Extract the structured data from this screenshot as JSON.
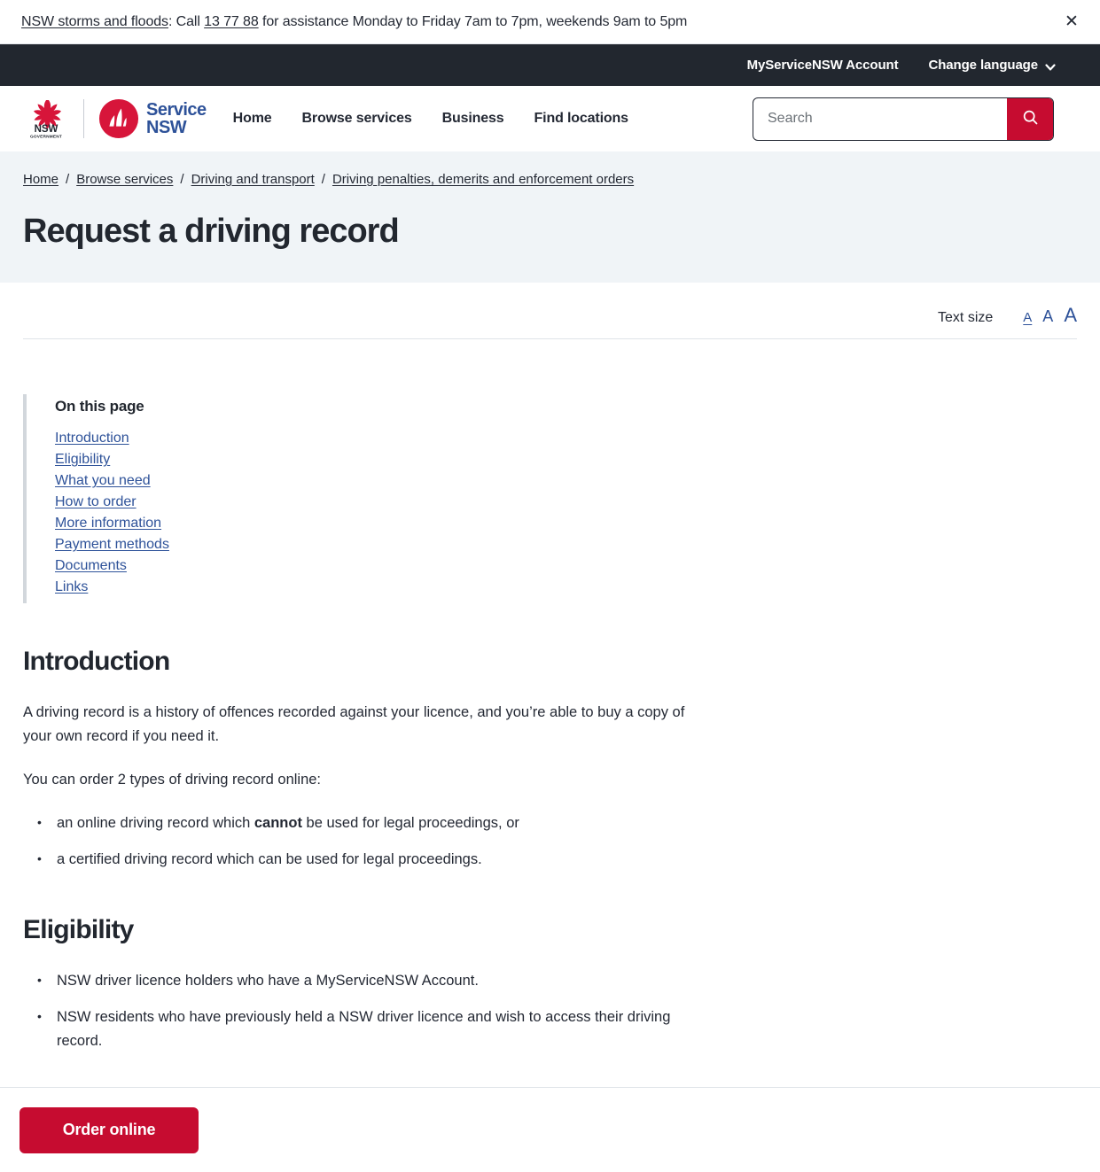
{
  "alert": {
    "link_text": "NSW storms and floods",
    "mid_text": ": Call ",
    "phone": "13 77 88",
    "tail_text": " for assistance Monday to Friday 7am to 7pm, weekends 9am to 5pm",
    "close_label": "✕"
  },
  "utility": {
    "account_label": "MyServiceNSW Account",
    "language_label": "Change language"
  },
  "header": {
    "logo_nsw_line1": "NSW",
    "logo_nsw_line2": "GOVERNMENT",
    "logo_service_line1": "Service",
    "logo_service_line2": "NSW",
    "nav": [
      {
        "label": "Home"
      },
      {
        "label": "Browse services"
      },
      {
        "label": "Business"
      },
      {
        "label": "Find locations"
      }
    ],
    "search": {
      "placeholder": "Search",
      "value": "",
      "button_label": "Search"
    }
  },
  "hero": {
    "breadcrumb": [
      {
        "label": "Home"
      },
      {
        "label": "Browse services"
      },
      {
        "label": "Driving and transport"
      },
      {
        "label": "Driving penalties, demerits and enforcement orders"
      }
    ],
    "separator": "/",
    "title": "Request a driving record"
  },
  "textsize": {
    "label": "Text size",
    "options": [
      "A",
      "A",
      "A"
    ]
  },
  "on_this_page": {
    "title": "On this page",
    "links": [
      {
        "label": "Introduction"
      },
      {
        "label": "Eligibility"
      },
      {
        "label": "What you need"
      },
      {
        "label": "How to order"
      },
      {
        "label": "More information"
      },
      {
        "label": "Payment methods"
      },
      {
        "label": "Documents"
      },
      {
        "label": "Links"
      }
    ]
  },
  "introduction": {
    "heading": "Introduction",
    "para1": "A driving record is a history of offences recorded against your licence, and you’re able to buy a copy of your own record if you need it.",
    "para2": "You can order 2 types of driving record online:",
    "bullet1_pre": "an online driving record which ",
    "bullet1_bold": "cannot",
    "bullet1_post": " be used for legal proceedings, or",
    "bullet2": "a certified driving record which can be used for legal proceedings."
  },
  "eligibility": {
    "heading": "Eligibility",
    "bullet1": "NSW driver licence holders who have a MyServiceNSW Account.",
    "bullet2": "NSW residents who have previously held a NSW driver licence and wish to access their driving record."
  },
  "action_bar": {
    "primary_button": "Order online"
  },
  "colors": {
    "brand_red": "#c60c30",
    "brand_blue": "#2e5299",
    "dark": "#22272f",
    "hero_bg": "#f0f4f7"
  }
}
